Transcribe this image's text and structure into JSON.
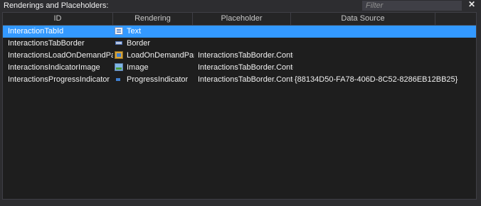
{
  "panel": {
    "title": "Renderings and Placeholders:",
    "filter_placeholder": "Filter",
    "close_symbol": "✕"
  },
  "columns": [
    "ID",
    "Rendering",
    "Placeholder",
    "Data Source",
    ""
  ],
  "rows": [
    {
      "id": "InteractionTabId",
      "rendering": "Text",
      "rendering_icon": "text-icon",
      "placeholder": "",
      "data_source": "",
      "selected": true
    },
    {
      "id": "InteractionsTabBorder",
      "rendering": "Border",
      "rendering_icon": "border-icon",
      "placeholder": "",
      "data_source": "",
      "selected": false
    },
    {
      "id": "InteractionsLoadOnDemandPanel",
      "rendering": "LoadOnDemandPanel",
      "rendering_icon": "load-on-demand-panel-icon",
      "placeholder": "InteractionsTabBorder.Content",
      "data_source": "",
      "selected": false
    },
    {
      "id": "InteractionsIndicatorImage",
      "rendering": "Image",
      "rendering_icon": "image-icon",
      "placeholder": "InteractionsTabBorder.Content",
      "data_source": "",
      "selected": false
    },
    {
      "id": "InteractionsProgressIndicator",
      "rendering": "ProgressIndicator",
      "rendering_icon": "progress-indicator-icon",
      "placeholder": "InteractionsTabBorder.Content",
      "data_source": "{88134D50-FA78-406D-8C52-8286EB12BB25}",
      "selected": false
    }
  ],
  "colors": {
    "background": "#2d2d30",
    "grid_background": "#1e1e1e",
    "selection": "#3399ff",
    "text": "#f1f1f1"
  }
}
